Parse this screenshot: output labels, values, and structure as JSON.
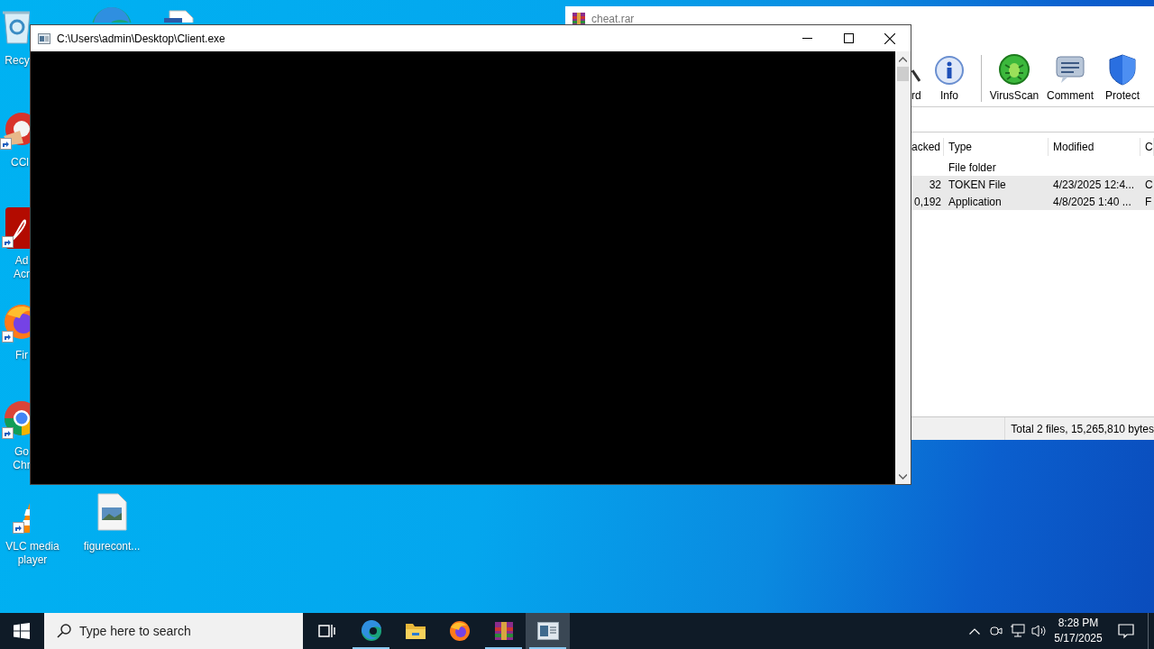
{
  "desktop_icons": [
    {
      "kind": "recycle-bin",
      "label_lines": [
        "Recy"
      ],
      "shortcut": false
    },
    {
      "kind": "edge",
      "shortcut": false
    },
    {
      "kind": "document",
      "shortcut": false
    },
    {
      "kind": "ccleaner",
      "label_lines": [
        "CCl"
      ],
      "shortcut": true
    },
    {
      "kind": "acrobat",
      "label_lines": [
        "Ad",
        "Acr"
      ],
      "shortcut": true
    },
    {
      "kind": "firefox",
      "label_lines": [
        "Fir"
      ],
      "shortcut": true
    },
    {
      "kind": "chrome",
      "label_lines": [
        "Go",
        "Chr"
      ],
      "shortcut": true
    },
    {
      "kind": "vlc",
      "label_lines": [
        "VLC media",
        "player"
      ],
      "shortcut": true
    },
    {
      "kind": "image-file",
      "label_lines": [
        "figurecont..."
      ],
      "shortcut": false
    }
  ],
  "archive_window": {
    "title": "cheat.rar",
    "toolbar": [
      {
        "kind": "partial",
        "label": "rd"
      },
      {
        "kind": "info",
        "label": "Info"
      },
      {
        "kind": "separator"
      },
      {
        "kind": "virusscan",
        "label": "VirusScan"
      },
      {
        "kind": "comment",
        "label": "Comment"
      },
      {
        "kind": "protect",
        "label": "Protect"
      }
    ],
    "columns": [
      "acked",
      "Type",
      "Modified",
      "C"
    ],
    "rows": [
      {
        "type": "File folder",
        "selected": false
      },
      {
        "packed": "32",
        "type": "TOKEN File",
        "modified": "4/23/2025 12:4...",
        "column_4": "C",
        "selected": true
      },
      {
        "packed": "0,192",
        "type": "Application",
        "modified": "4/8/2025 1:40 ...",
        "column_4": "F",
        "selected": true
      }
    ],
    "status": "Total 2 files, 15,265,810 bytes"
  },
  "console_window": {
    "title": "C:\\Users\\admin\\Desktop\\Client.exe"
  },
  "taskbar": {
    "search": {
      "placeholder": "Type here to search"
    },
    "apps": [
      {
        "kind": "task-view",
        "running": false,
        "active": false
      },
      {
        "kind": "edge",
        "running": true,
        "active": false
      },
      {
        "kind": "explorer",
        "running": false,
        "active": false
      },
      {
        "kind": "firefox",
        "running": false,
        "active": false
      },
      {
        "kind": "winrar",
        "running": true,
        "active": false
      },
      {
        "kind": "console",
        "running": true,
        "active": true
      }
    ],
    "time": "8:28 PM",
    "date": "5/17/2025"
  }
}
